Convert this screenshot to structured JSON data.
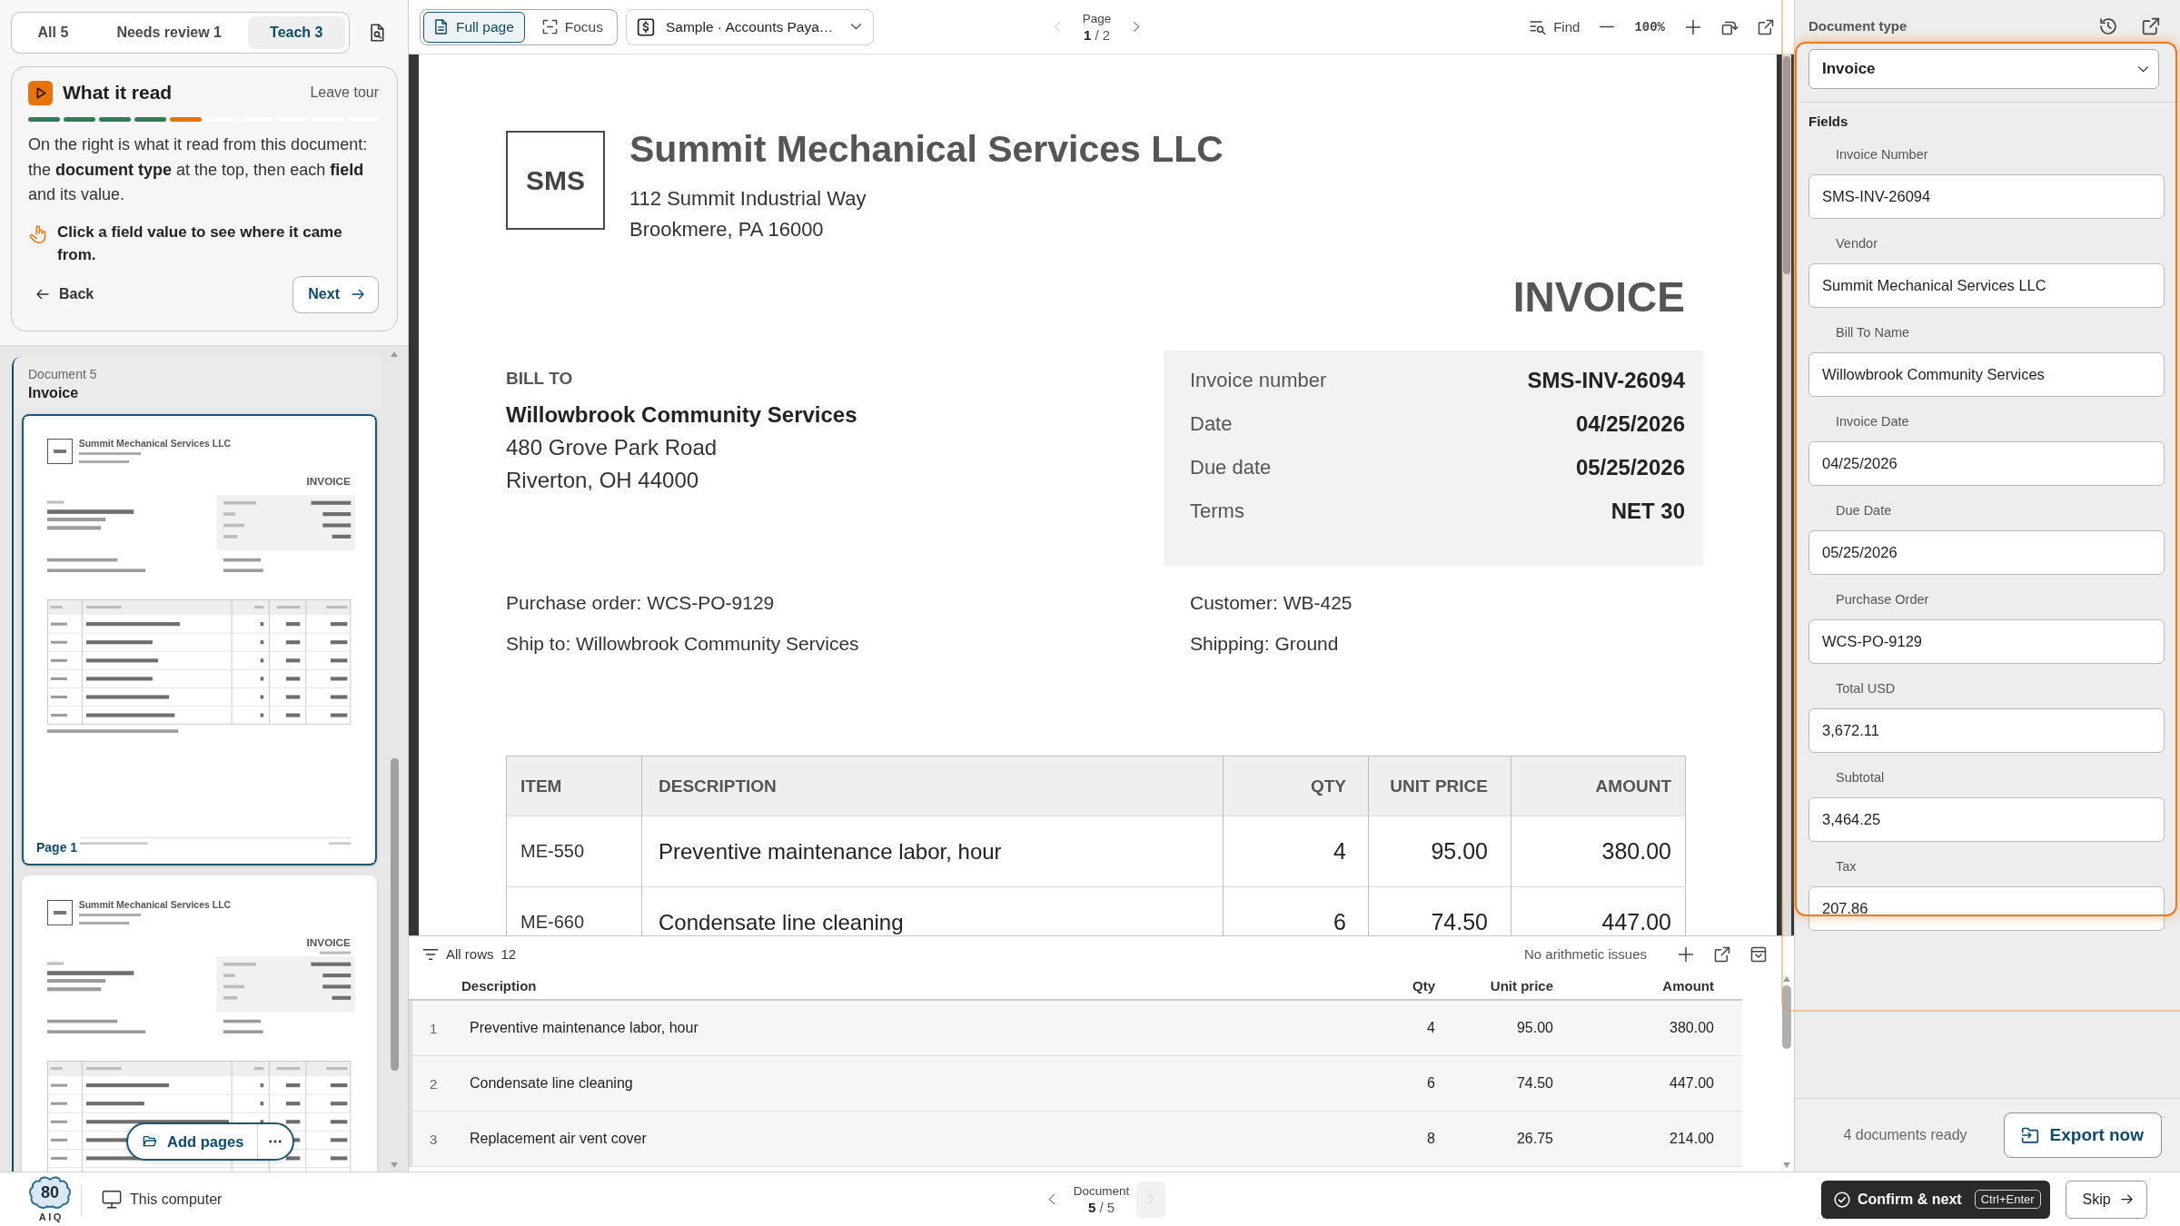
{
  "sidebar": {
    "tabs": [
      {
        "label": "All 5",
        "selected": false
      },
      {
        "label": "Needs review 1",
        "selected": false
      },
      {
        "label": "Teach 3",
        "selected": true
      }
    ],
    "tour": {
      "title": "What it read",
      "leave": "Leave tour",
      "steps": [
        {
          "kind": "done"
        },
        {
          "kind": "done"
        },
        {
          "kind": "done"
        },
        {
          "kind": "done"
        },
        {
          "kind": "current"
        },
        {
          "kind": "todo"
        },
        {
          "kind": "todo"
        },
        {
          "kind": "todo"
        },
        {
          "kind": "todo"
        },
        {
          "kind": "todo"
        }
      ],
      "body": "On the right is what it read from this document: the **document type** at the top, then each **field** and its value.",
      "tip": "Click a field value to see where it came from.",
      "back": "Back",
      "next": "Next"
    },
    "documents": [
      {
        "number": "Document 5",
        "type": "Invoice",
        "selected": true,
        "pages": [
          {
            "kind": "first",
            "label": "Page 1",
            "selected": true,
            "company": "Summit Mechanical Services LLC",
            "title": "INVOICE"
          },
          {
            "kind": "continued",
            "selected": false,
            "company": "Summit Mechanical Services LLC",
            "title": "INVOICE"
          }
        ]
      }
    ],
    "add_pages": "Add pages"
  },
  "toolbar": {
    "view_modes": [
      {
        "kind": "page",
        "label": "Full page",
        "selected": true
      },
      {
        "kind": "focus",
        "label": "Focus",
        "selected": false
      }
    ],
    "document": "Sample · Accounts Paya…",
    "page_label": "Page",
    "page_position": "**1** / 2",
    "prev_disabled": true,
    "next_disabled": false,
    "find": "Find",
    "zoom": "100%"
  },
  "viewer": {
    "page": {
      "logo": "SMS",
      "company": "Summit Mechanical Services LLC",
      "address": [
        "112 Summit Industrial Way",
        "Brookmere, PA 16000"
      ],
      "title": "INVOICE",
      "bill_to_label": "BILL TO",
      "bill_to_name": "Willowbrook Community Services",
      "bill_to_lines": [
        "480 Grove Park Road",
        "Riverton, OH 44000"
      ],
      "meta": [
        {
          "label": "Invoice number",
          "value": "SMS-INV-26094"
        },
        {
          "label": "Date",
          "value": "04/25/2026"
        },
        {
          "label": "Due date",
          "value": "05/25/2026"
        },
        {
          "label": "Terms",
          "value": "NET 30"
        }
      ],
      "references": [
        {
          "left": "Purchase order: WCS-PO-9129",
          "right": "Customer: WB-425"
        },
        {
          "left": "Ship to: Willowbrook Community Services",
          "right": "Shipping: Ground"
        }
      ],
      "columns": [
        "ITEM",
        "DESCRIPTION",
        "QTY",
        "UNIT PRICE",
        "AMOUNT"
      ],
      "rows": [
        {
          "item": "ME-550",
          "description": "Preventive maintenance labor, hour",
          "qty": "4",
          "unit_price": "95.00",
          "amount": "380.00"
        },
        {
          "item": "ME-660",
          "description": "Condensate line cleaning",
          "qty": "6",
          "unit_price": "74.50",
          "amount": "447.00"
        }
      ]
    }
  },
  "line_items": {
    "filter": "All rows",
    "count": "12",
    "status": "No arithmetic issues",
    "columns": [
      "Description",
      "Qty",
      "Unit price",
      "Amount"
    ],
    "rows": [
      {
        "number": "1",
        "description": "Preventive maintenance labor, hour",
        "qty": "4",
        "unit_price": "95.00",
        "amount": "380.00"
      },
      {
        "number": "2",
        "description": "Condensate line cleaning",
        "qty": "6",
        "unit_price": "74.50",
        "amount": "447.00"
      },
      {
        "number": "3",
        "description": "Replacement air vent cover",
        "qty": "8",
        "unit_price": "26.75",
        "amount": "214.00"
      }
    ]
  },
  "extraction": {
    "document_type_label": "Document type",
    "document_type": "Invoice",
    "fields_heading": "Fields",
    "fields": [
      {
        "label": "Invoice Number",
        "value": "SMS-INV-26094"
      },
      {
        "label": "Vendor",
        "value": "Summit Mechanical Services LLC"
      },
      {
        "label": "Bill To Name",
        "value": "Willowbrook Community Services"
      },
      {
        "label": "Invoice Date",
        "value": "04/25/2026"
      },
      {
        "label": "Due Date",
        "value": "05/25/2026"
      },
      {
        "label": "Purchase Order",
        "value": "WCS-PO-9129"
      },
      {
        "label": "Total USD",
        "value": "3,672.11"
      },
      {
        "label": "Subtotal",
        "value": "3,464.25"
      },
      {
        "label": "Tax",
        "value": "207.86"
      }
    ],
    "ready": "4 documents ready",
    "export": "Export now"
  },
  "footer": {
    "score": "80",
    "brand": "AIQ",
    "source": "This computer",
    "document_label": "Document",
    "document_position": "**5** / 5",
    "prev_disabled": false,
    "next_disabled": true,
    "confirm": "Confirm & next",
    "shortcut": "Ctrl+Enter",
    "skip": "Skip"
  }
}
